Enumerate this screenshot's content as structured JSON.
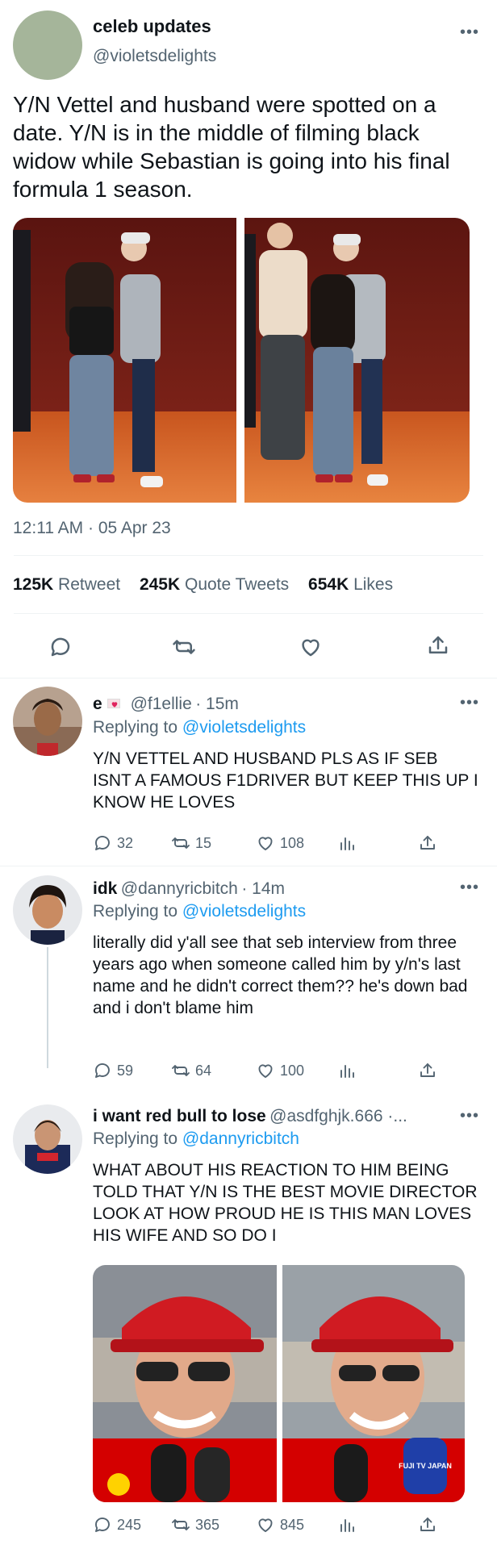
{
  "main_tweet": {
    "display_name": "celeb updates",
    "handle": "@violetsdelights",
    "text": "Y/N Vettel and husband were spotted on a date. Y/N is in the middle of filming black widow while Sebastian is going into his final formula 1 season.",
    "timestamp": "12:11 AM · 05 Apr 23",
    "stats": {
      "retweets_count": "125K",
      "retweets_label": "Retweet",
      "quotes_count": "245K",
      "quotes_label": "Quote Tweets",
      "likes_count": "654K",
      "likes_label": "Likes"
    }
  },
  "replies": [
    {
      "display_name": "e",
      "handle": "@f1ellie",
      "time": "· 15m",
      "replying_prefix": "Replying to",
      "replying_to": "@violetsdelights",
      "text": "Y/N VETTEL AND HUSBAND PLS AS IF SEB ISNT A FAMOUS F1DRIVER BUT KEEP THIS UP I KNOW HE LOVES",
      "replies": "32",
      "retweets": "15",
      "likes": "108"
    },
    {
      "display_name": "idk",
      "handle": "@dannyricbitch",
      "time": "· 14m",
      "replying_prefix": "Replying to",
      "replying_to": "@violetsdelights",
      "text": "literally did y'all see that seb interview from three years ago when someone called him by y/n's last name and he didn't correct them?? he's down bad and i don't blame him",
      "replies": "59",
      "retweets": "64",
      "likes": "100"
    },
    {
      "display_name": "i want red bull to lose",
      "handle": "@asdfghjk.666 ·...",
      "replying_prefix": "Replying to",
      "replying_to": "@dannyricbitch",
      "text": "WHAT ABOUT HIS REACTION TO HIM BEING TOLD THAT Y/N IS THE BEST MOVIE DIRECTOR LOOK AT HOW PROUD HE IS THIS MAN LOVES HIS WIFE AND SO DO I",
      "replies": "245",
      "retweets": "365",
      "likes": "845",
      "mic_label": "FUJI TV JAPAN"
    }
  ],
  "icons": {
    "more": "more-icon",
    "reply": "reply-icon",
    "retweet": "retweet-icon",
    "like": "heart-icon",
    "share": "share-icon",
    "analytics": "analytics-icon"
  },
  "colors": {
    "accent": "#1d9bf0",
    "muted": "#536471",
    "text": "#0f1419",
    "heart_badge": "#e0245e",
    "ferrari_red": "#d40000"
  }
}
